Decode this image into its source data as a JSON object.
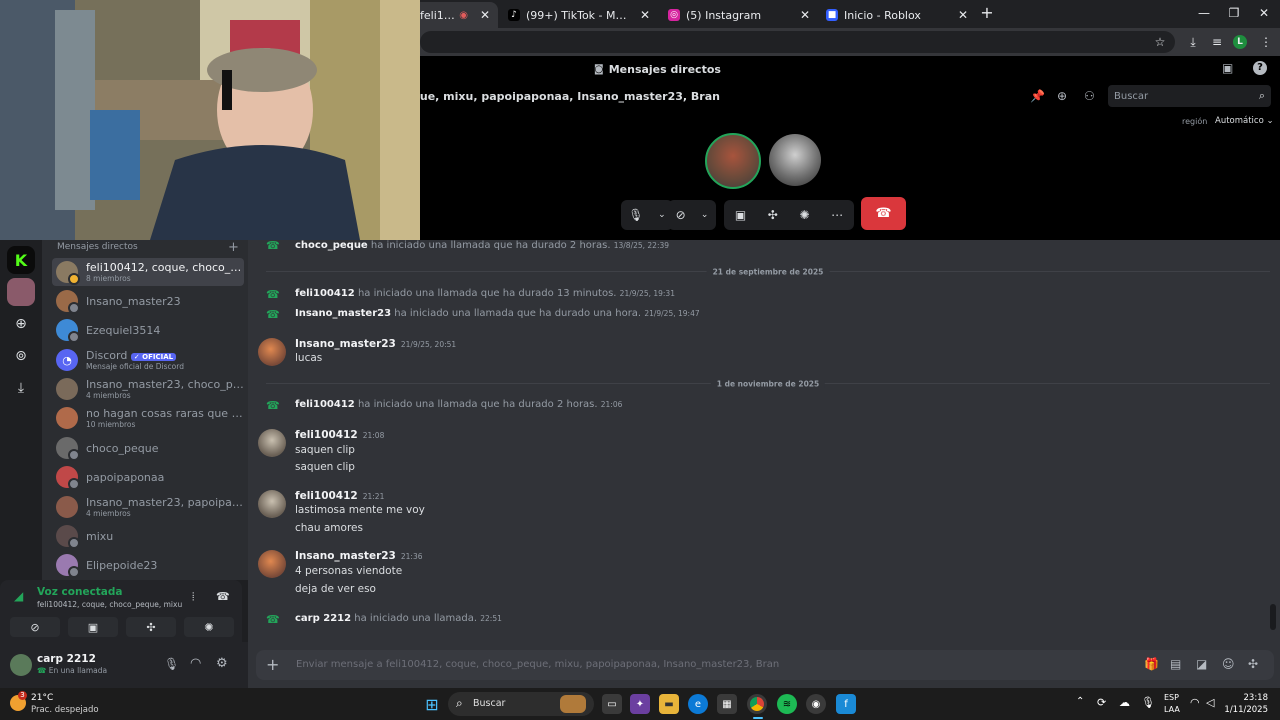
{
  "browser": {
    "tabs": [
      {
        "title": "feli100412, coque",
        "active": true
      },
      {
        "title": "(99+) TikTok - Make Your Day",
        "active": false
      },
      {
        "title": "(5) Instagram",
        "active": false
      },
      {
        "title": "Inicio - Roblox",
        "active": false
      }
    ],
    "new_tab": "+",
    "profile_initial": "L"
  },
  "call": {
    "header_label": "Mensajes directos",
    "group_title": "feli100412, coque, mixu, papoipaponaa, Insano_master23, Bran",
    "search_placeholder": "Buscar",
    "region_label": "región",
    "region_value": "Automático"
  },
  "sidebar": {
    "header": "Mensajes directos",
    "add": "+",
    "items": [
      {
        "name": "feli100412, coque, choco_peq...",
        "sub": "8 miembros",
        "color": "#8a7a62"
      },
      {
        "name": "Insano_master23",
        "sub": "",
        "color": "#9a6a48"
      },
      {
        "name": "Ezequiel3514",
        "sub": "",
        "color": "#3e8ad6"
      },
      {
        "name": "Discord",
        "badge": "✓ OFICIAL",
        "sub": "Mensaje oficial de Discord",
        "color": "#5865f2"
      },
      {
        "name": "Insano_master23, choco_peq...",
        "sub": "4 miembros",
        "color": "#7a6a5a"
      },
      {
        "name": "no hagan cosas raras que esta...",
        "sub": "10 miembros",
        "color": "#b06a4a"
      },
      {
        "name": "choco_peque",
        "sub": "",
        "color": "#6a6a6a"
      },
      {
        "name": "papoipaponaa",
        "sub": "",
        "color": "#c04848"
      },
      {
        "name": "Insano_master23, papoipapo...",
        "sub": "4 miembros",
        "color": "#8a5a4a"
      },
      {
        "name": "mixu",
        "sub": "",
        "color": "#5a4a4a"
      },
      {
        "name": "Elipepoide23",
        "sub": "",
        "color": "#9a7ab0"
      }
    ]
  },
  "voice": {
    "status": "Voz conectada",
    "channel": "feli100412, coque, choco_peque, mixu, ..."
  },
  "user": {
    "name": "carp 2212",
    "status": "En una llamada"
  },
  "chat": {
    "line0": {
      "author": "choco_peque",
      "text": "ha iniciado una llamada que ha durado 2 horas.",
      "ts": "13/8/25, 22:39"
    },
    "div1": "21 de septiembre de 2025",
    "line1": {
      "author": "feli100412",
      "text": "ha iniciado una llamada que ha durado 13 minutos.",
      "ts": "21/9/25, 19:31"
    },
    "line2": {
      "author": "Insano_master23",
      "text": "ha iniciado una llamada que ha durado una hora.",
      "ts": "21/9/25, 19:47"
    },
    "msg1": {
      "author": "Insano_master23",
      "ts": "21/9/25, 20:51",
      "lines": [
        "lucas"
      ]
    },
    "div2": "1 de noviembre de 2025",
    "line3": {
      "author": "feli100412",
      "text": "ha iniciado una llamada que ha durado 2 horas.",
      "ts": "21:06"
    },
    "msg2": {
      "author": "feli100412",
      "ts": "21:08",
      "lines": [
        "saquen clip",
        "saquen clip"
      ]
    },
    "msg3": {
      "author": "feli100412",
      "ts": "21:21",
      "lines": [
        "lastimosa mente me voy",
        "chau amores"
      ]
    },
    "msg4": {
      "author": "Insano_master23",
      "ts": "21:36",
      "lines": [
        "4 personas viendote",
        "deja de ver eso"
      ]
    },
    "line4": {
      "author": "carp 2212",
      "text": "ha iniciado una llamada.",
      "ts": "22:51"
    },
    "composer_placeholder": "Enviar mensaje a feli100412, coque, choco_peque, mixu, papoipaponaa, Insano_master23, Bran"
  },
  "taskbar": {
    "weather_temp": "21°C",
    "weather_desc": "Prac. despejado",
    "weather_badge": "3",
    "search": "Buscar",
    "lang1": "ESP",
    "lang2": "LAA",
    "time": "23:18",
    "date": "1/11/2025"
  }
}
